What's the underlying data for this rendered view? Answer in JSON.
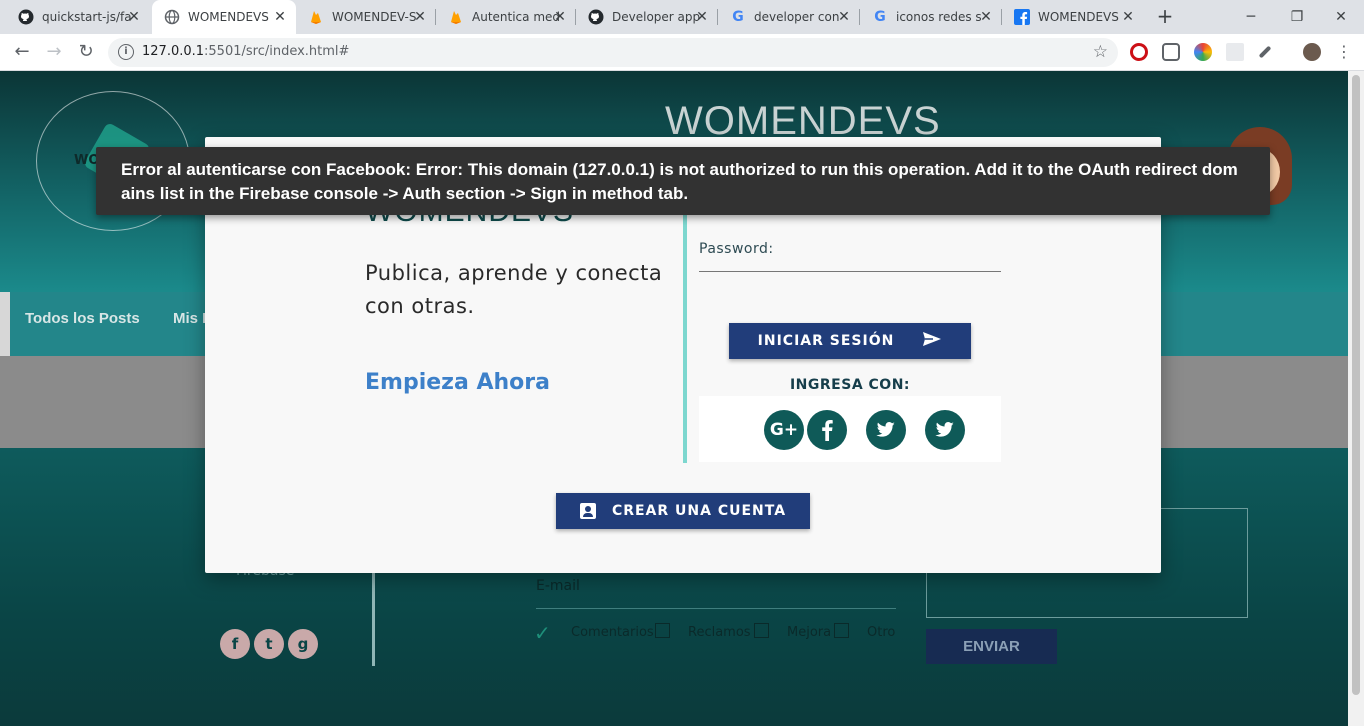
{
  "browser": {
    "tabs": [
      {
        "title": "quickstart-js/fa",
        "icon": "github-icon",
        "active": false
      },
      {
        "title": "WOMENDEVS",
        "icon": "globe-icon",
        "active": true
      },
      {
        "title": "WOMENDEV-S",
        "icon": "firebase-icon",
        "active": false
      },
      {
        "title": "Autentica med",
        "icon": "firebase-icon",
        "active": false
      },
      {
        "title": "Developer app",
        "icon": "github-icon",
        "active": false
      },
      {
        "title": "developer con",
        "icon": "google-icon",
        "active": false
      },
      {
        "title": "iconos redes s",
        "icon": "google-icon",
        "active": false
      },
      {
        "title": "WOMENDEVS",
        "icon": "facebook-icon",
        "active": false
      }
    ],
    "url_host": "127.0.0.1",
    "url_rest": ":5501/src/index.html#"
  },
  "page": {
    "header_title": "WOMENDEVS",
    "logo_text": "WO",
    "nav": [
      "Todos los Posts",
      "Mis P"
    ],
    "footer": {
      "firebase": "Firebase",
      "email_label": "E-mail",
      "options": [
        "Comentarios",
        "Reclamos",
        "Mejora",
        "Otro"
      ],
      "send_label": "ENVIAR"
    }
  },
  "modal": {
    "brand": "WOMENDEVS",
    "tagline": "Publica, aprende y conecta con otras.",
    "cta": "Empieza Ahora",
    "password_label": "Password:",
    "login_label": "INICIAR SESIÓN",
    "ingresa_label": "INGRESA CON:",
    "social": [
      "google-plus-icon",
      "facebook-icon",
      "twitter-icon",
      "twitter-icon"
    ],
    "create_label": "CREAR UNA CUENTA"
  },
  "toast": {
    "message": "Error al autenticarse con Facebook: Error: This domain (127.0.0.1) is not authorized to run this operation. Add it to the OAuth redirect dom ains list in the Firebase console -> Auth section -> Sign in method tab."
  },
  "colors": {
    "header_dark": "#0b3536",
    "nav_teal": "#23868a",
    "button_navy": "#213d7a",
    "accent_line": "#7dd7cf",
    "cta_blue": "#3d80c9",
    "toast_bg": "#323232"
  }
}
